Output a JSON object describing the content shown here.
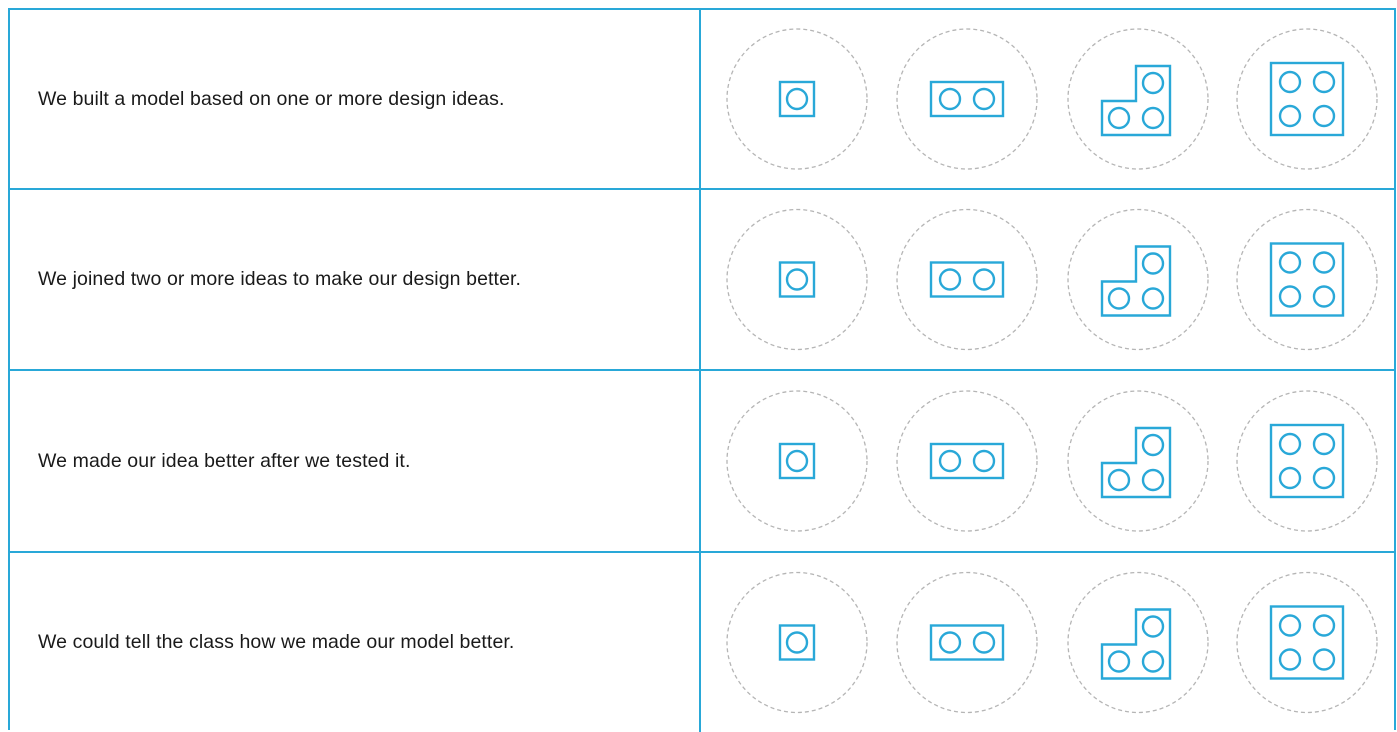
{
  "colors": {
    "border": "#29a8d8",
    "brick": "#29a8d8",
    "dashed_circle": "#b5b5b5",
    "text": "#1a1a1a"
  },
  "rubric": {
    "rows": [
      {
        "statement": "We built a model based on one or more design ideas."
      },
      {
        "statement": "We joined two or more ideas to make our design better."
      },
      {
        "statement": "We made our idea better after we tested it."
      },
      {
        "statement": "We could tell the class how we made our model better."
      }
    ],
    "levels": [
      {
        "icon": "brick-1x1-icon",
        "studs": 1
      },
      {
        "icon": "brick-1x2-icon",
        "studs": 2
      },
      {
        "icon": "brick-l-shape-icon",
        "studs": 3
      },
      {
        "icon": "brick-2x2-icon",
        "studs": 4
      }
    ]
  }
}
